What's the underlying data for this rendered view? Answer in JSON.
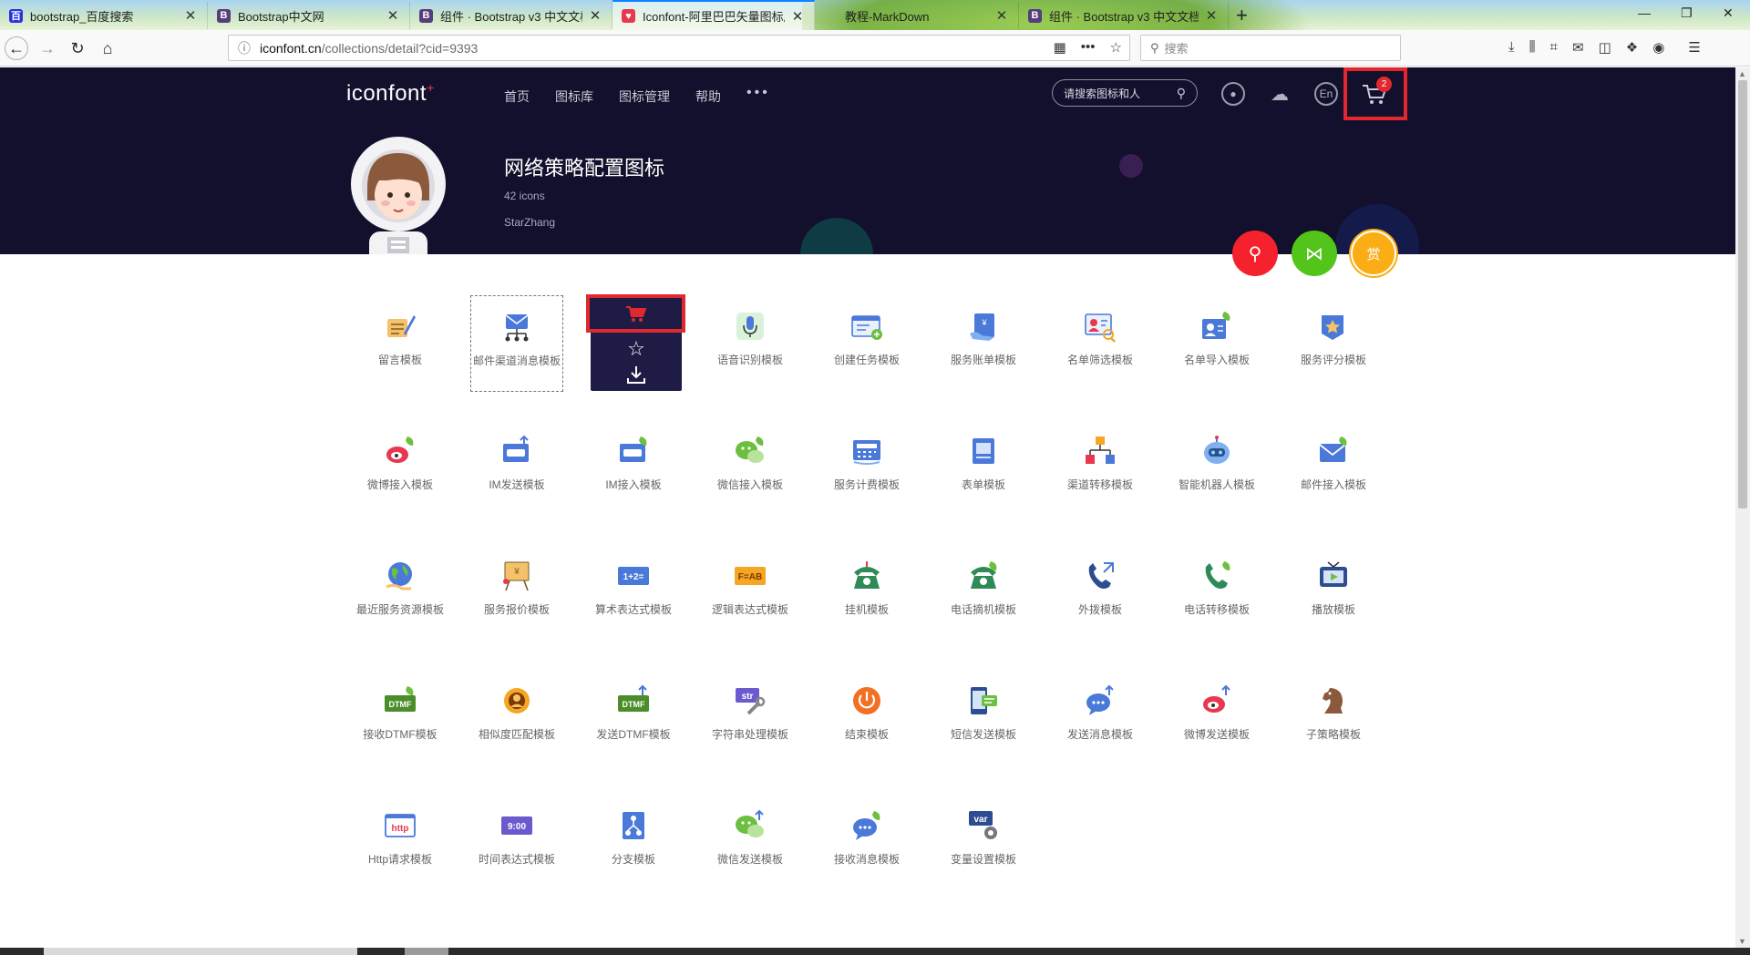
{
  "browser": {
    "tabs": [
      {
        "title": "bootstrap_百度搜索",
        "fav": "百",
        "fav_color": "#2932e1"
      },
      {
        "title": "Bootstrap中文网",
        "fav": "B",
        "fav_color": "#563d7c"
      },
      {
        "title": "组件 · Bootstrap v3 中文文档",
        "fav": "B",
        "fav_color": "#563d7c"
      },
      {
        "title": "Iconfont-阿里巴巴矢量图标库",
        "fav": "♥",
        "fav_color": "#e8384f"
      },
      {
        "title": "教程-MarkDown",
        "fav": "",
        "fav_color": "transparent"
      },
      {
        "title": "组件 · Bootstrap v3 中文文档",
        "fav": "B",
        "fav_color": "#563d7c"
      }
    ],
    "tab_close": "✕",
    "new_tab": "+",
    "url_host": "iconfont.cn",
    "url_path": "/collections/detail?cid=9393",
    "search_placeholder": "搜索"
  },
  "site": {
    "logo": "iconfont",
    "logo_mark": "+",
    "nav": [
      "首页",
      "图标库",
      "图标管理",
      "帮助"
    ],
    "nav_more": "•••",
    "search_placeholder": "请搜索图标和人",
    "lang_icon": "En",
    "cart_count": "2",
    "accent": "#e0282e",
    "header_bg": "#12102c"
  },
  "collection": {
    "title": "网络策略配置图标",
    "count": "42 icons",
    "author": "StarZhang"
  },
  "fabs": [
    {
      "name": "search-fab",
      "color": "#f5222d",
      "glyph": "⚲"
    },
    {
      "name": "share-fab",
      "color": "#52c41a",
      "glyph": "⋈"
    },
    {
      "name": "reward-fab",
      "color": "#faad14",
      "glyph": "赏"
    }
  ],
  "icons": [
    {
      "label": "留言模板",
      "kind": "note"
    },
    {
      "label": "邮件渠道消息模板",
      "kind": "mailnet"
    },
    {
      "label": "",
      "kind": "hover"
    },
    {
      "label": "语音识别模板",
      "kind": "mic"
    },
    {
      "label": "创建任务模板",
      "kind": "task"
    },
    {
      "label": "服务账单模板",
      "kind": "bill"
    },
    {
      "label": "名单筛选模板",
      "kind": "filter"
    },
    {
      "label": "名单导入模板",
      "kind": "import"
    },
    {
      "label": "服务评分模板",
      "kind": "score"
    },
    {
      "label": "微博接入模板",
      "kind": "weibo"
    },
    {
      "label": "IM发送模板",
      "kind": "imsend"
    },
    {
      "label": "IM接入模板",
      "kind": "imin"
    },
    {
      "label": "微信接入模板",
      "kind": "wechat"
    },
    {
      "label": "服务计费模板",
      "kind": "calc"
    },
    {
      "label": "表单模板",
      "kind": "form"
    },
    {
      "label": "渠道转移模板",
      "kind": "tree"
    },
    {
      "label": "智能机器人模板",
      "kind": "robot"
    },
    {
      "label": "邮件接入模板",
      "kind": "mailin"
    },
    {
      "label": "最近服务资源模板",
      "kind": "globe"
    },
    {
      "label": "服务报价模板",
      "kind": "quote"
    },
    {
      "label": "算术表达式模板",
      "kind": "arith",
      "text": "1+2="
    },
    {
      "label": "逻辑表达式模板",
      "kind": "logic",
      "text": "F=AB"
    },
    {
      "label": "挂机模板",
      "kind": "hang"
    },
    {
      "label": "电话摘机模板",
      "kind": "pickup"
    },
    {
      "label": "外拨模板",
      "kind": "outcall"
    },
    {
      "label": "电话转移模板",
      "kind": "transfer"
    },
    {
      "label": "播放模板",
      "kind": "play"
    },
    {
      "label": "接收DTMF模板",
      "kind": "dtmfin",
      "text": "DTMF"
    },
    {
      "label": "相似度匹配模板",
      "kind": "match"
    },
    {
      "label": "发送DTMF模板",
      "kind": "dtmfout",
      "text": "DTMF"
    },
    {
      "label": "字符串处理模板",
      "kind": "str",
      "text": "str"
    },
    {
      "label": "结束模板",
      "kind": "end"
    },
    {
      "label": "短信发送模板",
      "kind": "sms"
    },
    {
      "label": "发送消息模板",
      "kind": "msgsend"
    },
    {
      "label": "微博发送模板",
      "kind": "weibosend"
    },
    {
      "label": "子策略模板",
      "kind": "chess"
    },
    {
      "label": "Http请求模板",
      "kind": "http",
      "text": "http"
    },
    {
      "label": "时间表达式模板",
      "kind": "time",
      "text": "9:00"
    },
    {
      "label": "分支模板",
      "kind": "branch"
    },
    {
      "label": "微信发送模板",
      "kind": "wechatsend"
    },
    {
      "label": "接收消息模板",
      "kind": "msgin"
    },
    {
      "label": "变量设置模板",
      "kind": "var",
      "text": "var"
    }
  ]
}
